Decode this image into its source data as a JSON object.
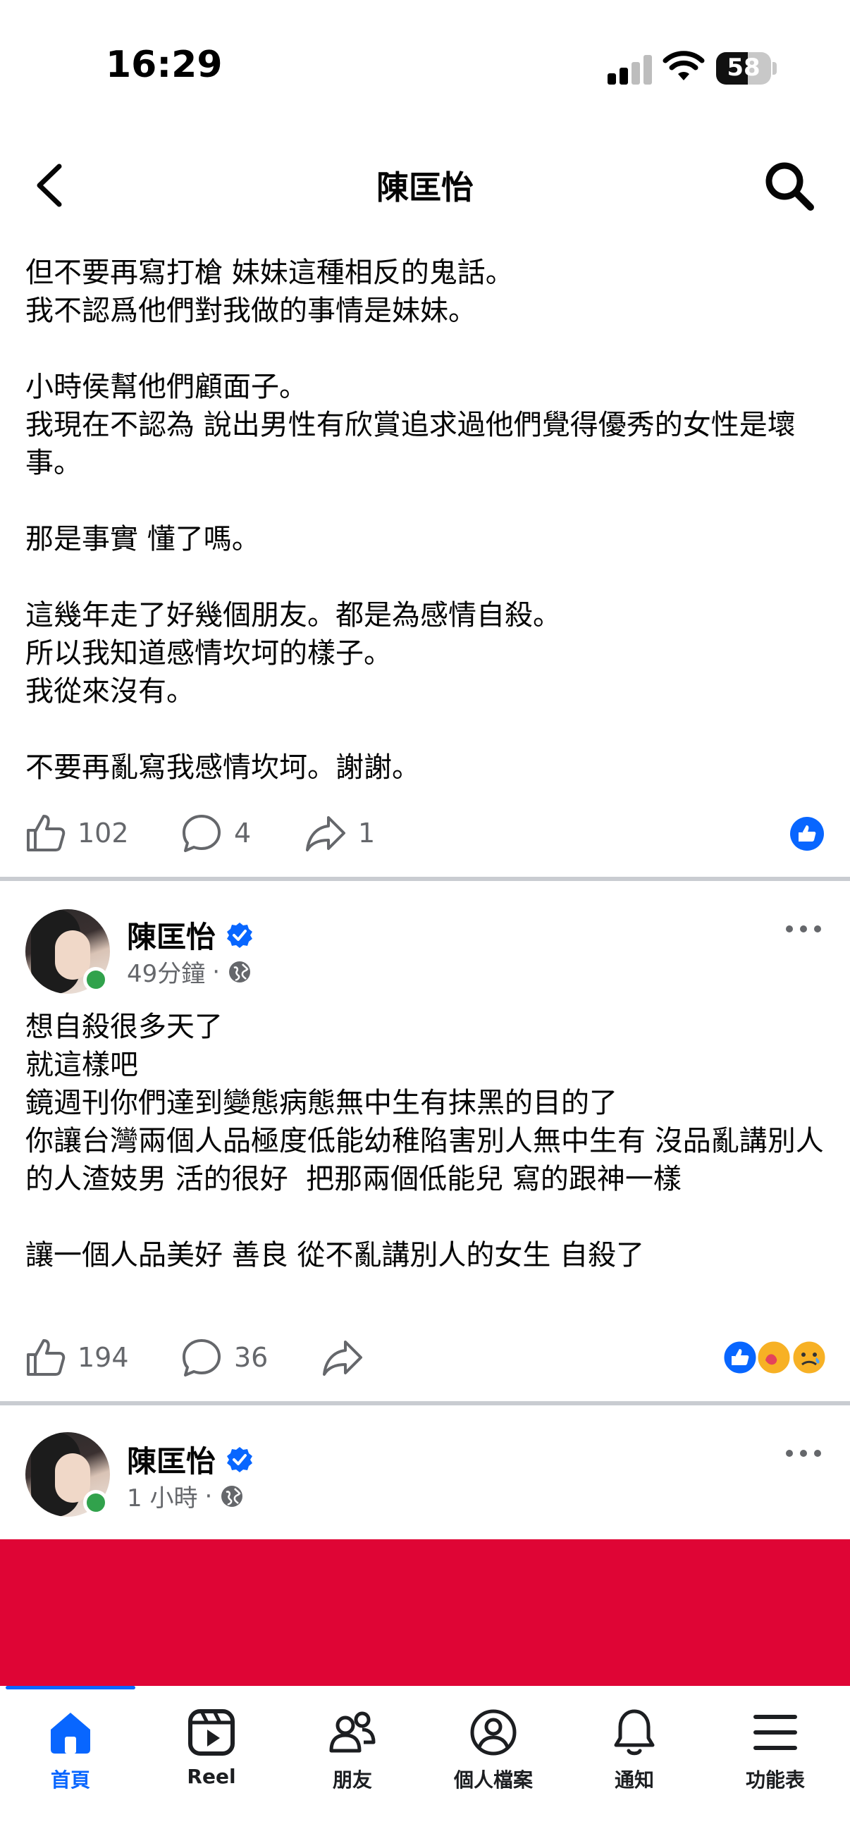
{
  "status_bar": {
    "time": "16:29",
    "battery": "58",
    "battery_level_percent": 58
  },
  "header": {
    "title": "陳匡怡",
    "back_icon": "chevron-left-icon",
    "search_icon": "search-icon"
  },
  "post1": {
    "text": "但不要再寫打槍 妹妹這種相反的鬼話。\n我不認爲他們對我做的事情是妹妹。\n\n小時侯幫他們顧面子。\n我現在不認為 說出男性有欣賞追求過他們覺得優秀的女性是壞事。\n\n那是事實 懂了嗎。\n\n這幾年走了好幾個朋友。都是為感情自殺。\n所以我知道感情坎坷的樣子。\n我從來沒有。\n\n不要再亂寫我感情坎坷。謝謝。",
    "likes": "102",
    "comments": "4",
    "shares": "1"
  },
  "post2": {
    "author": "陳匡怡",
    "time": "49分鐘",
    "text": "想自殺很多天了\n就這樣吧\n鏡週刊你們達到變態病態無中生有抹黑的目的了\n你讓台灣兩個人品極度低能幼稚陷害別人無中生有 沒品亂講別人的人渣妓男 活的很好  把那兩個低能兒 寫的跟神一樣\n\n讓一個人品美好 善良 從不亂講別人的女生 自殺了",
    "likes": "194",
    "comments": "36"
  },
  "post3": {
    "author": "陳匡怡",
    "time": "1 小時"
  },
  "nav": {
    "items": [
      {
        "label": "首頁",
        "icon": "home-icon"
      },
      {
        "label": "Reel",
        "icon": "reel-icon"
      },
      {
        "label": "朋友",
        "icon": "friends-icon"
      },
      {
        "label": "個人檔案",
        "icon": "profile-icon"
      },
      {
        "label": "通知",
        "icon": "bell-icon"
      },
      {
        "label": "功能表",
        "icon": "menu-icon"
      }
    ]
  },
  "colors": {
    "accent": "#0866ff",
    "banner": "#df0535",
    "online": "#31a24c",
    "muted": "#65676b"
  }
}
